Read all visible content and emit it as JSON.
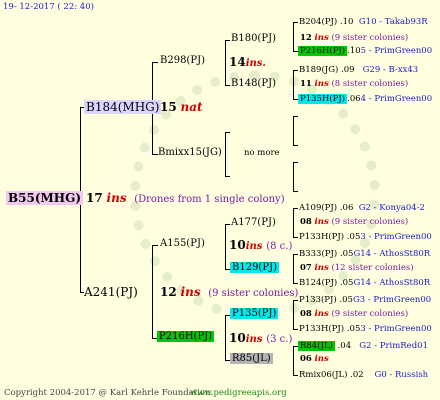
{
  "header": {
    "date": "19- 12-2017 ( 22: 40)"
  },
  "footer": {
    "copyright": "Copyright 2004-2017 @ Karl Kehrle Foundation.",
    "url": "www.pedigreeapis.org"
  },
  "root": {
    "name": "B55(MHG)",
    "count": "17",
    "ins": "ins",
    "note": "(Drones from 1 single colony)"
  },
  "gen1": {
    "top": {
      "name": "B184(MHG)",
      "count": "15",
      "tag": "nat"
    },
    "bottom": {
      "name": "A241(PJ)",
      "count": "12",
      "ins": "ins",
      "note": "(9 sister colonies)"
    }
  },
  "gen2": {
    "b298": {
      "name": "B298(PJ)",
      "count": "14",
      "ins": "ins."
    },
    "bmix": {
      "name": "Bmixx15(JG)",
      "note": "no more"
    },
    "a155": {
      "name": "A155(PJ)",
      "count": "10",
      "ins": "ins",
      "note": "(8 c.)"
    },
    "p216": {
      "name": "P216H(PJ)",
      "count": "10",
      "ins": "ins",
      "note": "(3 c.)"
    }
  },
  "gen3": {
    "b180": {
      "name": "B180(PJ)",
      "count": "12",
      "ins": "ins",
      "note": "(9 sister colonies)"
    },
    "b148": {
      "name": "B148(PJ)",
      "count": "11",
      "ins": "ins",
      "note": "(8 sister colonies)"
    },
    "a177": {
      "name": "A177(PJ)",
      "count": "08",
      "ins": "ins",
      "note": "(9 sister colonies)"
    },
    "b129": {
      "name": "B129(PJ)",
      "count": "07",
      "ins": "ins",
      "note": "(12 sister colonies)"
    },
    "p135": {
      "name": "P135(PJ)",
      "count": "08",
      "ins": "ins",
      "note": "(9 sister colonies)"
    },
    "r85": {
      "name": "R85(JL)",
      "count": "06",
      "ins": "ins"
    }
  },
  "gen4": {
    "r1": {
      "name": "B204(PJ)",
      "num": ".10",
      "line": "G10 - Takab93R"
    },
    "r2": {
      "name": "P216H(PJ)",
      "num": ".10",
      "line": "5 - PrimGreen00"
    },
    "r3": {
      "name": "B189(JG)",
      "num": ".09",
      "line": "G29 - B-xx43"
    },
    "r4": {
      "name": "P135H(PJ)",
      "num": ".06",
      "line": "4 - PrimGreen00"
    },
    "r5": {
      "name": "A109(PJ)",
      "num": ".06",
      "line": "G2 - Konya04-2"
    },
    "r6": {
      "name": "P133H(PJ)",
      "num": ".05",
      "line": "3 - PrimGreen00"
    },
    "r7": {
      "name": "B333(PJ)",
      "num": ".05",
      "line": "G14 - AthosSt80R"
    },
    "r8": {
      "name": "B124(PJ)",
      "num": ".05",
      "line": "G14 - AthosSt80R"
    },
    "r9": {
      "name": "P133(PJ)",
      "num": ".05",
      "line": "G3 - PrimGreen00"
    },
    "r10": {
      "name": "P133H(PJ)",
      "num": ".05",
      "line": "3 - PrimGreen00"
    },
    "r11": {
      "name": "R84(JL)",
      "num": ".04",
      "line": "G2 - PrimRed01"
    },
    "r12": {
      "name": "Rmix06(JL)",
      "num": ".02",
      "line": "G0 - Russish"
    }
  }
}
